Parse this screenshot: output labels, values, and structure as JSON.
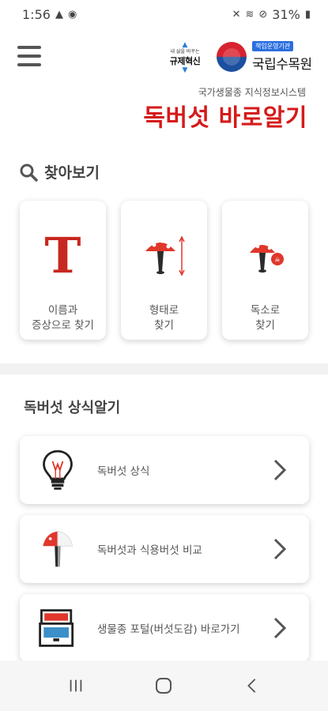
{
  "status_bar": {
    "time": "1:56",
    "battery": "31%"
  },
  "header": {
    "reg_logo_small": "내 삶을 바꾸는",
    "reg_logo_big": "규제혁신",
    "gov_tag": "책임운영기관",
    "gov_name": "국립수목원",
    "subtitle": "국가생물종 지식정보시스템",
    "title": "독버섯 바로알기"
  },
  "search": {
    "heading": "찾아보기",
    "cards": [
      {
        "label": "이름과\n증상으로 찾기",
        "icon": "text-t-icon"
      },
      {
        "label": "형태로\n찾기",
        "icon": "mushroom-shape-icon"
      },
      {
        "label": "독소로\n찾기",
        "icon": "mushroom-toxin-icon"
      }
    ]
  },
  "knowledge": {
    "heading": "독버섯 상식알기",
    "items": [
      {
        "label": "독버섯 상식",
        "icon": "lightbulb-icon"
      },
      {
        "label": "독버섯과 식용버섯 비교",
        "icon": "mushroom-compare-icon"
      },
      {
        "label": "생물종 포털(버섯도감) 바로가기",
        "icon": "box-portal-icon"
      }
    ]
  },
  "colors": {
    "accent": "#d61a1a",
    "heading": "#444444",
    "divider": "#f2f2f2"
  }
}
